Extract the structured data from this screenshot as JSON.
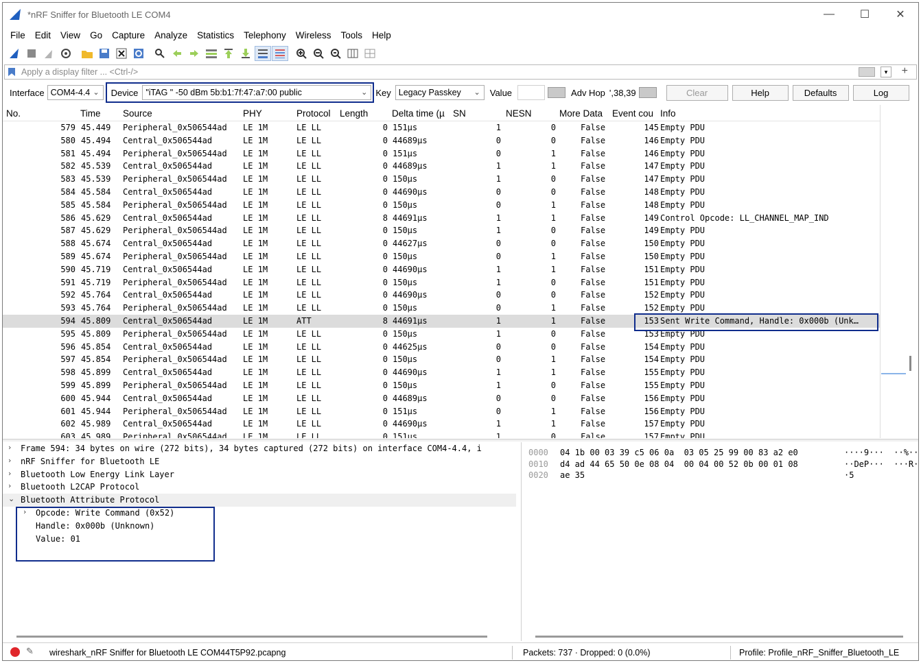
{
  "window": {
    "title": "*nRF Sniffer for Bluetooth LE COM4",
    "minimize": "—",
    "maximize": "☐",
    "close": "✕"
  },
  "menu": [
    "File",
    "Edit",
    "View",
    "Go",
    "Capture",
    "Analyze",
    "Statistics",
    "Telephony",
    "Wireless",
    "Tools",
    "Help"
  ],
  "filter": {
    "placeholder": "Apply a display filter ... <Ctrl-/>"
  },
  "sniffer": {
    "interface_label": "Interface",
    "interface_value": "COM4-4.4",
    "device_label": "Device",
    "device_value": "\"iTAG  \"  -50 dBm  5b:b1:7f:47:a7:00  public",
    "key_label": "Key",
    "key_value": "Legacy Passkey",
    "value_label": "Value",
    "adv_hop_label": "Adv Hop",
    "adv_hop_value": "',38,39",
    "clear": "Clear",
    "help": "Help",
    "defaults": "Defaults",
    "log": "Log"
  },
  "columns": [
    "No.",
    "Time",
    "Source",
    "PHY",
    "Protocol",
    "Length",
    "Delta time (µ",
    "SN",
    "NESN",
    "More Data",
    "Event cou",
    "Info"
  ],
  "packets": [
    [
      "579",
      "45.449",
      "Peripheral_0x506544ad",
      "LE 1M",
      "LE LL",
      "0",
      "151µs",
      "1",
      "0",
      "False",
      "145",
      "Empty PDU"
    ],
    [
      "580",
      "45.494",
      "Central_0x506544ad",
      "LE 1M",
      "LE LL",
      "0",
      "44689µs",
      "0",
      "0",
      "False",
      "146",
      "Empty PDU"
    ],
    [
      "581",
      "45.494",
      "Peripheral_0x506544ad",
      "LE 1M",
      "LE LL",
      "0",
      "151µs",
      "0",
      "1",
      "False",
      "146",
      "Empty PDU"
    ],
    [
      "582",
      "45.539",
      "Central_0x506544ad",
      "LE 1M",
      "LE LL",
      "0",
      "44689µs",
      "1",
      "1",
      "False",
      "147",
      "Empty PDU"
    ],
    [
      "583",
      "45.539",
      "Peripheral_0x506544ad",
      "LE 1M",
      "LE LL",
      "0",
      "150µs",
      "1",
      "0",
      "False",
      "147",
      "Empty PDU"
    ],
    [
      "584",
      "45.584",
      "Central_0x506544ad",
      "LE 1M",
      "LE LL",
      "0",
      "44690µs",
      "0",
      "0",
      "False",
      "148",
      "Empty PDU"
    ],
    [
      "585",
      "45.584",
      "Peripheral_0x506544ad",
      "LE 1M",
      "LE LL",
      "0",
      "150µs",
      "0",
      "1",
      "False",
      "148",
      "Empty PDU"
    ],
    [
      "586",
      "45.629",
      "Central_0x506544ad",
      "LE 1M",
      "LE LL",
      "8",
      "44691µs",
      "1",
      "1",
      "False",
      "149",
      "Control Opcode: LL_CHANNEL_MAP_IND"
    ],
    [
      "587",
      "45.629",
      "Peripheral_0x506544ad",
      "LE 1M",
      "LE LL",
      "0",
      "150µs",
      "1",
      "0",
      "False",
      "149",
      "Empty PDU"
    ],
    [
      "588",
      "45.674",
      "Central_0x506544ad",
      "LE 1M",
      "LE LL",
      "0",
      "44627µs",
      "0",
      "0",
      "False",
      "150",
      "Empty PDU"
    ],
    [
      "589",
      "45.674",
      "Peripheral_0x506544ad",
      "LE 1M",
      "LE LL",
      "0",
      "150µs",
      "0",
      "1",
      "False",
      "150",
      "Empty PDU"
    ],
    [
      "590",
      "45.719",
      "Central_0x506544ad",
      "LE 1M",
      "LE LL",
      "0",
      "44690µs",
      "1",
      "1",
      "False",
      "151",
      "Empty PDU"
    ],
    [
      "591",
      "45.719",
      "Peripheral_0x506544ad",
      "LE 1M",
      "LE LL",
      "0",
      "150µs",
      "1",
      "0",
      "False",
      "151",
      "Empty PDU"
    ],
    [
      "592",
      "45.764",
      "Central_0x506544ad",
      "LE 1M",
      "LE LL",
      "0",
      "44690µs",
      "0",
      "0",
      "False",
      "152",
      "Empty PDU"
    ],
    [
      "593",
      "45.764",
      "Peripheral_0x506544ad",
      "LE 1M",
      "LE LL",
      "0",
      "150µs",
      "0",
      "1",
      "False",
      "152",
      "Empty PDU"
    ],
    [
      "594",
      "45.809",
      "Central_0x506544ad",
      "LE 1M",
      "ATT",
      "8",
      "44691µs",
      "1",
      "1",
      "False",
      "153",
      "Sent Write Command, Handle: 0x000b (Unk…"
    ],
    [
      "595",
      "45.809",
      "Peripheral_0x506544ad",
      "LE 1M",
      "LE LL",
      "0",
      "150µs",
      "1",
      "0",
      "False",
      "153",
      "Empty PDU"
    ],
    [
      "596",
      "45.854",
      "Central_0x506544ad",
      "LE 1M",
      "LE LL",
      "0",
      "44625µs",
      "0",
      "0",
      "False",
      "154",
      "Empty PDU"
    ],
    [
      "597",
      "45.854",
      "Peripheral_0x506544ad",
      "LE 1M",
      "LE LL",
      "0",
      "150µs",
      "0",
      "1",
      "False",
      "154",
      "Empty PDU"
    ],
    [
      "598",
      "45.899",
      "Central_0x506544ad",
      "LE 1M",
      "LE LL",
      "0",
      "44690µs",
      "1",
      "1",
      "False",
      "155",
      "Empty PDU"
    ],
    [
      "599",
      "45.899",
      "Peripheral_0x506544ad",
      "LE 1M",
      "LE LL",
      "0",
      "150µs",
      "1",
      "0",
      "False",
      "155",
      "Empty PDU"
    ],
    [
      "600",
      "45.944",
      "Central_0x506544ad",
      "LE 1M",
      "LE LL",
      "0",
      "44689µs",
      "0",
      "0",
      "False",
      "156",
      "Empty PDU"
    ],
    [
      "601",
      "45.944",
      "Peripheral_0x506544ad",
      "LE 1M",
      "LE LL",
      "0",
      "151µs",
      "0",
      "1",
      "False",
      "156",
      "Empty PDU"
    ],
    [
      "602",
      "45.989",
      "Central_0x506544ad",
      "LE 1M",
      "LE LL",
      "0",
      "44690µs",
      "1",
      "1",
      "False",
      "157",
      "Empty PDU"
    ],
    [
      "603",
      "45.989",
      "Peripheral_0x506544ad",
      "LE 1M",
      "LE LL",
      "0",
      "151µs",
      "1",
      "0",
      "False",
      "157",
      "Empty PDU"
    ]
  ],
  "selected_packet": "594",
  "details": [
    {
      "text": "Frame 594: 34 bytes on wire (272 bits), 34 bytes captured (272 bits) on interface COM4-4.4, i",
      "expander": "›"
    },
    {
      "text": "nRF Sniffer for Bluetooth LE",
      "expander": "›"
    },
    {
      "text": "Bluetooth Low Energy Link Layer",
      "expander": "›"
    },
    {
      "text": "Bluetooth L2CAP Protocol",
      "expander": "›"
    },
    {
      "text": "Bluetooth Attribute Protocol",
      "expander": "⌄"
    }
  ],
  "att_fields": [
    {
      "text": "Opcode: Write Command (0x52)",
      "expander": "›"
    },
    {
      "text": "Handle: 0x000b (Unknown)",
      "expander": ""
    },
    {
      "text": "Value: 01",
      "expander": ""
    }
  ],
  "bytes": [
    {
      "offset": "0000",
      "hex": "04 1b 00 03 39 c5 06 0a  03 05 25 99 00 83 a2 e0",
      "ascii": "····9···  ··%·····"
    },
    {
      "offset": "0010",
      "hex": "d4 ad 44 65 50 0e 08 04  00 04 00 52 0b 00 01 08",
      "ascii": "··DeP···  ···R····"
    },
    {
      "offset": "0020",
      "hex": "ae 35",
      "ascii": "·5"
    }
  ],
  "status": {
    "file": "wireshark_nRF Sniffer for Bluetooth LE COM44T5P92.pcapng",
    "packets": "Packets: 737 · Dropped: 0 (0.0%)",
    "profile": "Profile: Profile_nRF_Sniffer_Bluetooth_LE"
  },
  "colors": {
    "highlight_box": "#0f2c8c",
    "selected_row": "#dcdcdc",
    "shark_fin": "#1f5fbf"
  }
}
